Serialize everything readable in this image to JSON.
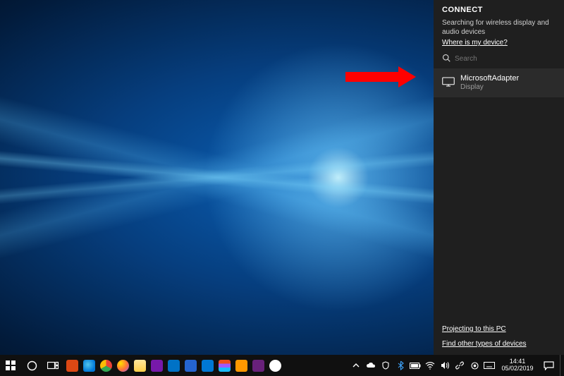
{
  "connect": {
    "title": "CONNECT",
    "status": "Searching for wireless display and audio devices",
    "where_link": "Where is my device?",
    "search_placeholder": "Search",
    "device": {
      "name": "MicrosoftAdapter",
      "type": "Display"
    },
    "projecting_link": "Projecting to this PC",
    "find_other_link": "Find other types of devices"
  },
  "taskbar": {
    "time": "14:41",
    "date": "05/02/2019"
  },
  "colors": {
    "panel_bg": "#1f1f1f",
    "device_bg": "#2b2b2b",
    "taskbar_bg": "#101010",
    "arrow": "#ff0000"
  },
  "pins": [
    {
      "name": "ubuntu",
      "color": "#dd4814"
    },
    {
      "name": "edge",
      "color": "#0078d7"
    },
    {
      "name": "chrome",
      "color": "#ffffff"
    },
    {
      "name": "firefox",
      "color": "#ff7139"
    },
    {
      "name": "file-explorer",
      "color": "#ffcf48"
    },
    {
      "name": "onenote",
      "color": "#7719aa"
    },
    {
      "name": "outlook",
      "color": "#0072c6"
    },
    {
      "name": "todo",
      "color": "#2564cf"
    },
    {
      "name": "azure-cli",
      "color": "#0078d4"
    },
    {
      "name": "figma",
      "color": "#a259ff"
    },
    {
      "name": "sublime",
      "color": "#ff9800"
    },
    {
      "name": "vs",
      "color": "#68217a"
    },
    {
      "name": "basecamp",
      "color": "#ffffff"
    }
  ]
}
